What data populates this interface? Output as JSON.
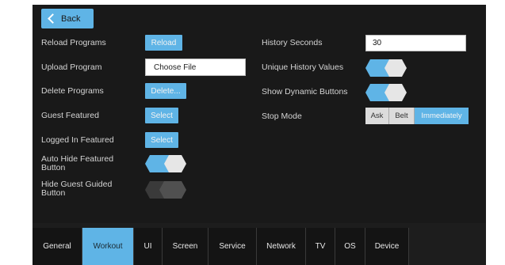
{
  "colors": {
    "accent": "#5fb4e6",
    "panel": "#191919",
    "toggle_off": "#4a4a4a"
  },
  "back": {
    "label": "Back",
    "icon": "chevron-left-icon"
  },
  "left": {
    "reload_programs": {
      "label": "Reload Programs",
      "button": "Reload"
    },
    "upload_program": {
      "label": "Upload Program",
      "button": "Choose File"
    },
    "delete_programs": {
      "label": "Delete Programs",
      "button": "Delete..."
    },
    "guest_featured": {
      "label": "Guest Featured",
      "button": "Select"
    },
    "logged_in_featured": {
      "label": "Logged In Featured",
      "button": "Select"
    },
    "auto_hide_featured": {
      "label": "Auto Hide Featured Button",
      "state": "on"
    },
    "hide_guest_guided": {
      "label": "Hide Guest Guided Button",
      "state": "off"
    }
  },
  "right": {
    "history_seconds": {
      "label": "History Seconds",
      "value": "30"
    },
    "unique_history_values": {
      "label": "Unique History Values",
      "state": "on"
    },
    "show_dynamic_buttons": {
      "label": "Show Dynamic Buttons",
      "state": "on"
    },
    "stop_mode": {
      "label": "Stop Mode",
      "options": [
        "Ask",
        "Belt",
        "Immediately"
      ],
      "selected": "Immediately"
    }
  },
  "tabs": [
    {
      "label": "General"
    },
    {
      "label": "Workout",
      "active": true
    },
    {
      "label": "UI"
    },
    {
      "label": "Screen"
    },
    {
      "label": "Service"
    },
    {
      "label": "Network"
    },
    {
      "label": "TV"
    },
    {
      "label": "OS"
    },
    {
      "label": "Device"
    }
  ]
}
